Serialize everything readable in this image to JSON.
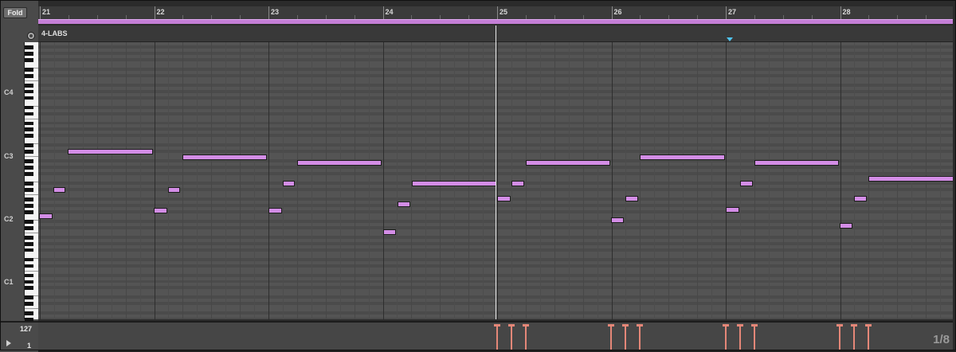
{
  "toolbar": {
    "fold_label": "Fold"
  },
  "ruler": {
    "bars": [
      "21",
      "22",
      "23",
      "24",
      "25",
      "26",
      "27",
      "28"
    ]
  },
  "clip": {
    "name": "4-LABS",
    "color": "#c47fd6"
  },
  "keyboard": {
    "octave_labels": [
      "C4",
      "C3",
      "C2",
      "C1"
    ]
  },
  "velocity": {
    "max_label": "127",
    "min_label": "1"
  },
  "grid": {
    "resolution_label": "1/8"
  },
  "colors": {
    "note": "#d38de6",
    "velocity": "#e58778",
    "playhead": "#e8e8e8",
    "marker": "#4fc4f0"
  },
  "icons": {
    "fold_toggle": "circle-icon",
    "play": "play-icon",
    "marker": "triangle-down-icon"
  }
}
